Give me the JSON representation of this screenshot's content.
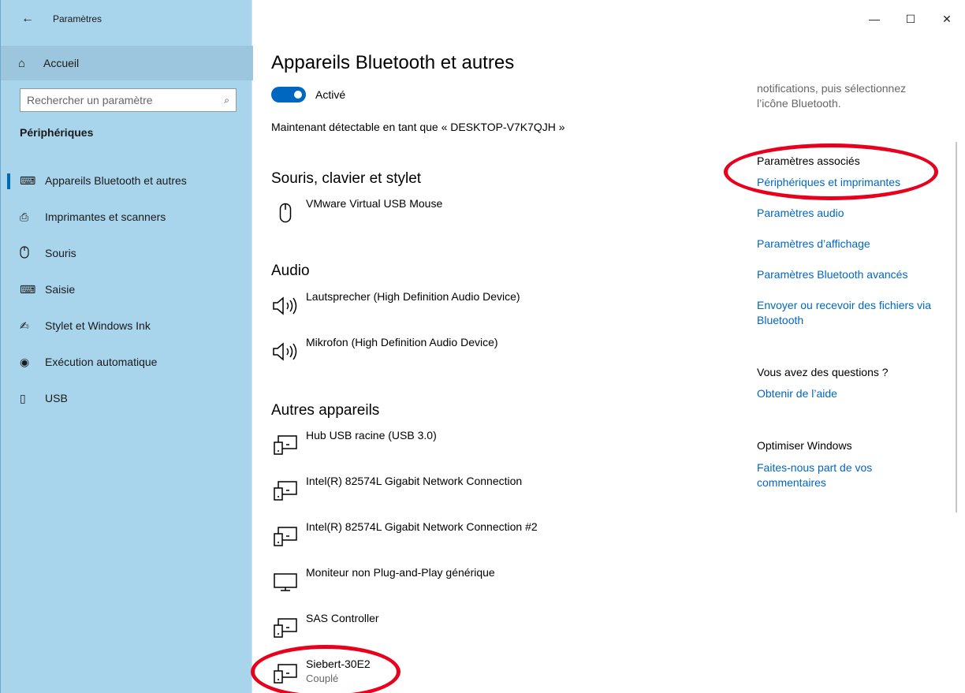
{
  "window": {
    "title": "Paramètres",
    "controls": {
      "minimize": "—",
      "maximize": "☐",
      "close": "✕"
    }
  },
  "sidebar": {
    "home_label": "Accueil",
    "search_placeholder": "Rechercher un paramètre",
    "section_title": "Périphériques",
    "items": [
      {
        "label": "Appareils Bluetooth et autres",
        "icon": "bluetooth-devices-icon",
        "glyph": "⌨",
        "active": true
      },
      {
        "label": "Imprimantes et scanners",
        "icon": "printer-icon",
        "glyph": "⎙",
        "active": false
      },
      {
        "label": "Souris",
        "icon": "mouse-icon",
        "glyph": "⌂",
        "active": false
      },
      {
        "label": "Saisie",
        "icon": "keyboard-icon",
        "glyph": "⌨",
        "active": false
      },
      {
        "label": "Stylet et Windows Ink",
        "icon": "pen-icon",
        "glyph": "✍",
        "active": false
      },
      {
        "label": "Exécution automatique",
        "icon": "autoplay-icon",
        "glyph": "◉",
        "active": false
      },
      {
        "label": "USB",
        "icon": "usb-icon",
        "glyph": "▯",
        "active": false
      }
    ]
  },
  "main": {
    "title": "Appareils Bluetooth et autres",
    "toggle_label": "Activé",
    "toggle_on": true,
    "discoverable": "Maintenant détectable en tant que « DESKTOP-V7K7QJH »",
    "groups": {
      "mouse_keyboard": {
        "title": "Souris, clavier et stylet",
        "devices": [
          {
            "name": "VMware Virtual USB Mouse",
            "icon": "mouse-icon"
          }
        ]
      },
      "audio": {
        "title": "Audio",
        "devices": [
          {
            "name": "Lautsprecher (High Definition Audio Device)",
            "icon": "speaker-icon"
          },
          {
            "name": "Mikrofon (High Definition Audio Device)",
            "icon": "speaker-icon"
          }
        ]
      },
      "other": {
        "title": "Autres appareils",
        "devices": [
          {
            "name": "Hub USB racine (USB 3.0)",
            "icon": "generic-device-icon"
          },
          {
            "name": "Intel(R) 82574L Gigabit Network Connection",
            "icon": "generic-device-icon"
          },
          {
            "name": "Intel(R) 82574L Gigabit Network Connection #2",
            "icon": "generic-device-icon"
          },
          {
            "name": "Moniteur non Plug-and-Play générique",
            "icon": "monitor-icon"
          },
          {
            "name": "SAS Controller",
            "icon": "generic-device-icon"
          },
          {
            "name": "Siebert-30E2",
            "status": "Couplé",
            "icon": "generic-device-icon"
          }
        ]
      }
    }
  },
  "right": {
    "intro_line1": "notifications, puis sélectionnez",
    "intro_line2": "l’icône Bluetooth.",
    "related_title": "Paramètres associés",
    "links": {
      "devices_printers": "Périphériques et imprimantes",
      "audio": "Paramètres audio",
      "display": "Paramètres d’affichage",
      "bluetooth_advanced": "Paramètres Bluetooth avancés",
      "send_receive_1": "Envoyer ou recevoir des fichiers via",
      "send_receive_2": "Bluetooth"
    },
    "questions_title": "Vous avez des questions ?",
    "help_link": "Obtenir de l’aide",
    "improve_title": "Optimiser Windows",
    "feedback_1": "Faites-nous part de vos",
    "feedback_2": "commentaires"
  },
  "colors": {
    "accent": "#0067c0",
    "sidebar": "#a8d4ec",
    "annotation": "#e8001c"
  }
}
